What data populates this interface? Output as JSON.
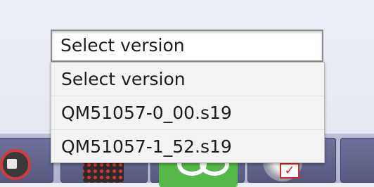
{
  "version_select": {
    "value": "Select version",
    "options": [
      {
        "label": "Select version"
      },
      {
        "label": "QM51057-0_00.s19"
      },
      {
        "label": "QM51057-1_52.s19"
      }
    ]
  },
  "toolbar": {
    "items": [
      {
        "icon": "gauge-icon"
      },
      {
        "icon": "keypad-icon"
      },
      {
        "icon": "infinity-icon"
      },
      {
        "icon": "chip-check-icon"
      },
      {
        "icon": "more-icon"
      }
    ]
  },
  "colors": {
    "background": "#ebedf6",
    "toolbar": "#55597f",
    "green_accent": "#57b84a",
    "alert_red": "#d62a2a"
  }
}
